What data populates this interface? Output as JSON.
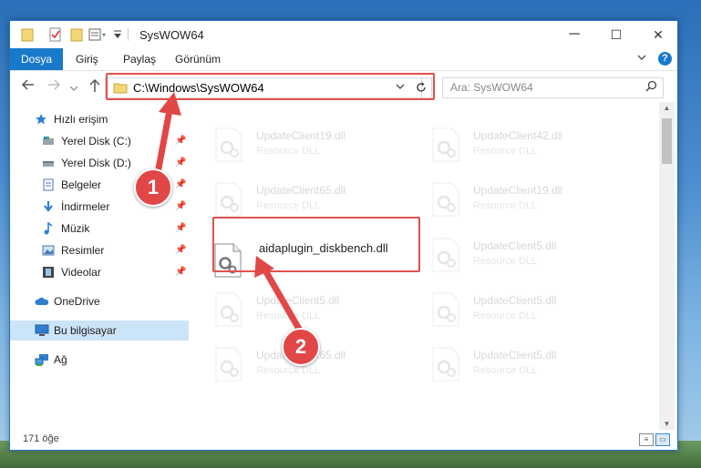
{
  "window": {
    "title": "SysWOW64",
    "controls": {
      "minimize": "─",
      "maximize": "☐",
      "close": "✕"
    }
  },
  "ribbon": {
    "tabs": [
      "Dosya",
      "Giriş",
      "Paylaş",
      "Görünüm"
    ]
  },
  "navbar": {
    "address": "C:\\Windows\\SysWOW64",
    "search_placeholder": "Ara: SysWOW64"
  },
  "sidebar": {
    "items": [
      {
        "label": "Hızlı erişim",
        "icon": "star-icon"
      },
      {
        "label": "Yerel Disk (C:)",
        "icon": "drive-icon"
      },
      {
        "label": "Yerel Disk (D:)",
        "icon": "drive-icon"
      },
      {
        "label": "Belgeler",
        "icon": "documents-icon"
      },
      {
        "label": "İndirmeler",
        "icon": "download-icon"
      },
      {
        "label": "Müzik",
        "icon": "music-icon"
      },
      {
        "label": "Resimler",
        "icon": "pictures-icon"
      },
      {
        "label": "Videolar",
        "icon": "video-icon"
      },
      {
        "label": "OneDrive",
        "icon": "cloud-icon"
      },
      {
        "label": "Bu bilgisayar",
        "icon": "computer-icon"
      },
      {
        "label": "Ağ",
        "icon": "network-icon"
      }
    ]
  },
  "files": [
    {
      "name": "UpdateClient19.dll",
      "type": "Resource DLL"
    },
    {
      "name": "UpdateClient42.dll",
      "type": "Resource DLL"
    },
    {
      "name": "UpdateClient65.dll",
      "type": "Resource DLL"
    },
    {
      "name": "UpdateClient19.dll",
      "type": "Resource DLL"
    },
    {
      "name": "aidaplugin_diskbench.dll",
      "type": ""
    },
    {
      "name": "UpdateClient5.dll",
      "type": "Resource DLL"
    },
    {
      "name": "UpdateClient5.dll",
      "type": "Resource DLL"
    },
    {
      "name": "UpdateClient5.dll",
      "type": "Resource DLL"
    },
    {
      "name": "UpdateClient65.dll",
      "type": "Resource DLL"
    },
    {
      "name": "UpdateClient5.dll",
      "type": "Resource DLL"
    }
  ],
  "status": {
    "count": "171 öğe"
  },
  "callouts": [
    "1",
    "2"
  ],
  "colors": {
    "accent": "#1979ca",
    "highlight": "#e05252",
    "selected": "#cce4f7"
  }
}
